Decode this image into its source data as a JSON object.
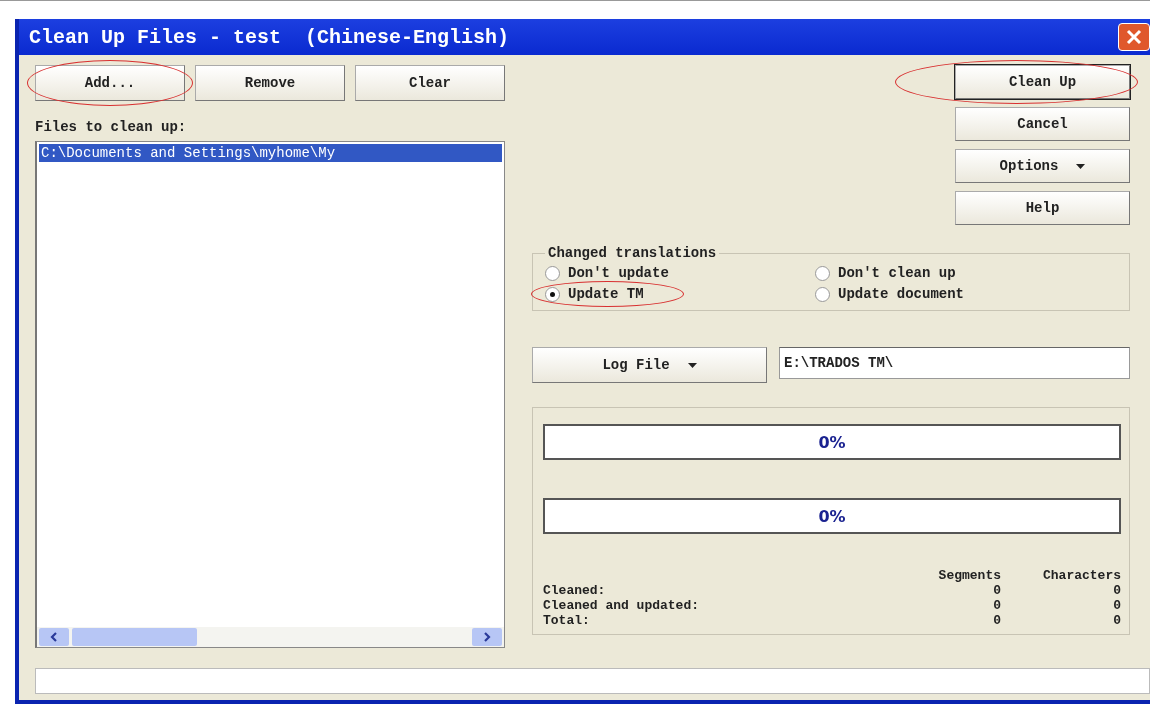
{
  "window": {
    "title": "Clean Up Files - test  (Chinese-English)"
  },
  "file_buttons": [
    {
      "label": "Add...",
      "circled": true
    },
    {
      "label": "Remove",
      "circled": false
    },
    {
      "label": "Clear",
      "circled": false
    }
  ],
  "files": {
    "label": "Files to clean up:",
    "items": [
      {
        "path": "C:\\Documents and Settings\\myhome\\My",
        "selected": true
      }
    ]
  },
  "action_buttons": [
    {
      "label": "Clean Up",
      "kind": "default",
      "circled": true
    },
    {
      "label": "Cancel",
      "kind": "plain",
      "circled": false
    },
    {
      "label": "Options",
      "kind": "menu",
      "circled": false
    },
    {
      "label": "Help",
      "kind": "plain",
      "circled": false
    }
  ],
  "changed_translations": {
    "title": "Changed translations",
    "options": [
      {
        "label": "Don't update",
        "selected": false,
        "circled": false
      },
      {
        "label": "Don't clean up",
        "selected": false,
        "circled": false
      },
      {
        "label": "Update TM",
        "selected": true,
        "circled": true
      },
      {
        "label": "Update document",
        "selected": false,
        "circled": false
      }
    ]
  },
  "log_file": {
    "label": "Log File",
    "value": "E:\\TRADOS TM\\"
  },
  "progress": [
    {
      "text": "0%",
      "level": 0
    },
    {
      "text": "0%",
      "level": 0
    }
  ],
  "stats": {
    "columns": [
      "Segments",
      "Characters"
    ],
    "rows": [
      {
        "label": "Cleaned:",
        "values": [
          "0",
          "0"
        ]
      },
      {
        "label": "Cleaned and updated:",
        "values": [
          "0",
          "0"
        ]
      },
      {
        "label": "Total:",
        "values": [
          "0",
          "0"
        ]
      }
    ]
  }
}
